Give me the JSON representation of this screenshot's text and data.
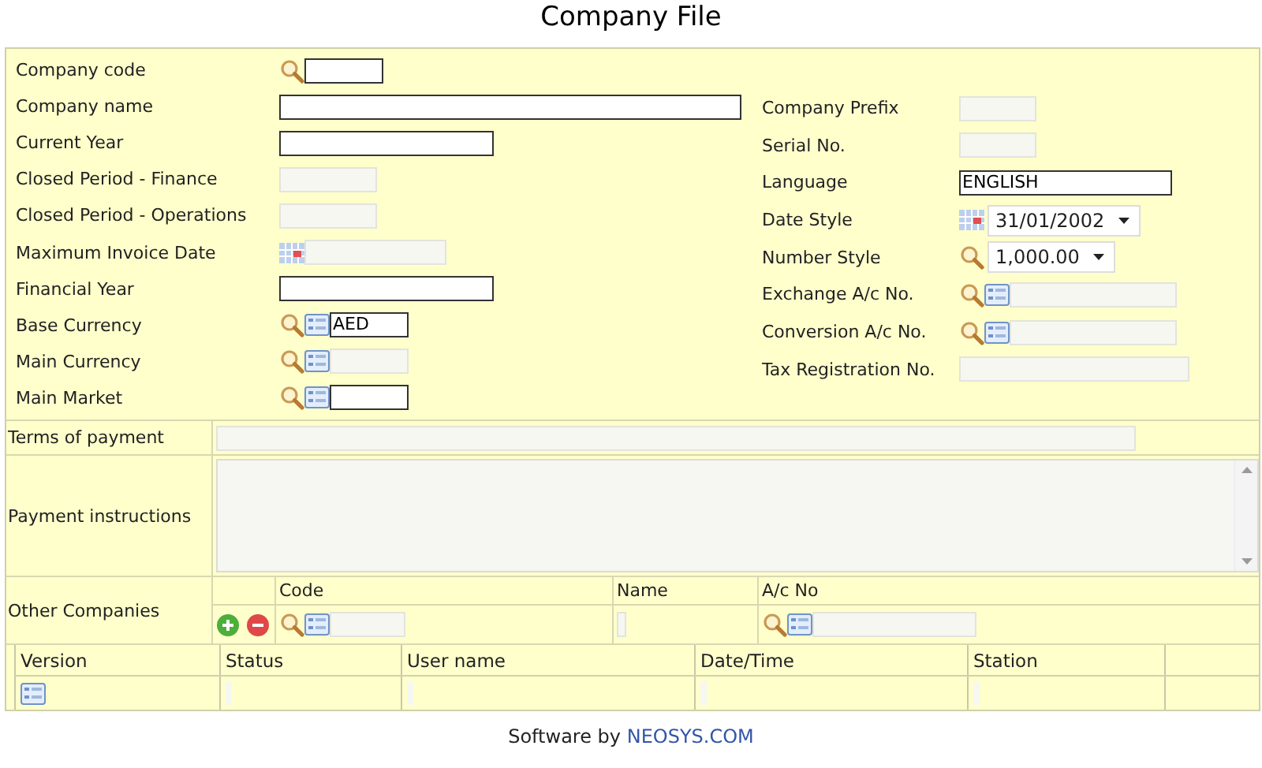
{
  "title": "Company File",
  "left_fields": [
    {
      "label": "Company code",
      "kind": "search",
      "disabled": false
    },
    {
      "label": "Company name",
      "kind": "plain",
      "disabled": false
    },
    {
      "label": "Current Year",
      "kind": "plain",
      "disabled": false
    },
    {
      "label": "Closed Period - Finance",
      "kind": "plain",
      "disabled": true
    },
    {
      "label": "Closed Period - Operations",
      "kind": "plain",
      "disabled": true
    },
    {
      "label": "Maximum Invoice Date",
      "kind": "calendar",
      "disabled": true
    },
    {
      "label": "Financial Year",
      "kind": "plain",
      "disabled": false
    },
    {
      "label": "Base Currency",
      "kind": "lookup",
      "disabled": false,
      "value": "AED"
    },
    {
      "label": "Main Currency",
      "kind": "lookup",
      "disabled": true
    },
    {
      "label": "Main Market",
      "kind": "lookup",
      "disabled": false
    }
  ],
  "right_fields": [
    {
      "label": "Company Prefix",
      "kind": "plain",
      "disabled": true
    },
    {
      "label": "Serial No.",
      "kind": "plain",
      "disabled": true
    },
    {
      "label": "Language",
      "kind": "plain",
      "disabled": false,
      "value": "ENGLISH"
    },
    {
      "label": "Date Style",
      "kind": "datepick",
      "disabled": false,
      "value": "31/01/2002"
    },
    {
      "label": "Number Style",
      "kind": "choice",
      "disabled": false,
      "value": "1,000.00"
    },
    {
      "label": "Exchange A/c No.",
      "kind": "lookup",
      "disabled": true
    },
    {
      "label": "Conversion A/c No.",
      "kind": "lookup",
      "disabled": true
    },
    {
      "label": "Tax Registration No.",
      "kind": "plain",
      "disabled": true
    }
  ],
  "terms_of_payment": {
    "label": "Terms of payment",
    "disabled": true
  },
  "payment_instructions": {
    "label": "Payment instructions",
    "disabled": true
  },
  "other_companies": {
    "label": "Other Companies",
    "columns": [
      "Code",
      "Name",
      "A/c No"
    ]
  },
  "versions": {
    "columns": [
      "Version",
      "Status",
      "User name",
      "Date/Time",
      "Station"
    ]
  },
  "footer": {
    "prefix": "Software by",
    "link": "NEOSYS.COM"
  }
}
